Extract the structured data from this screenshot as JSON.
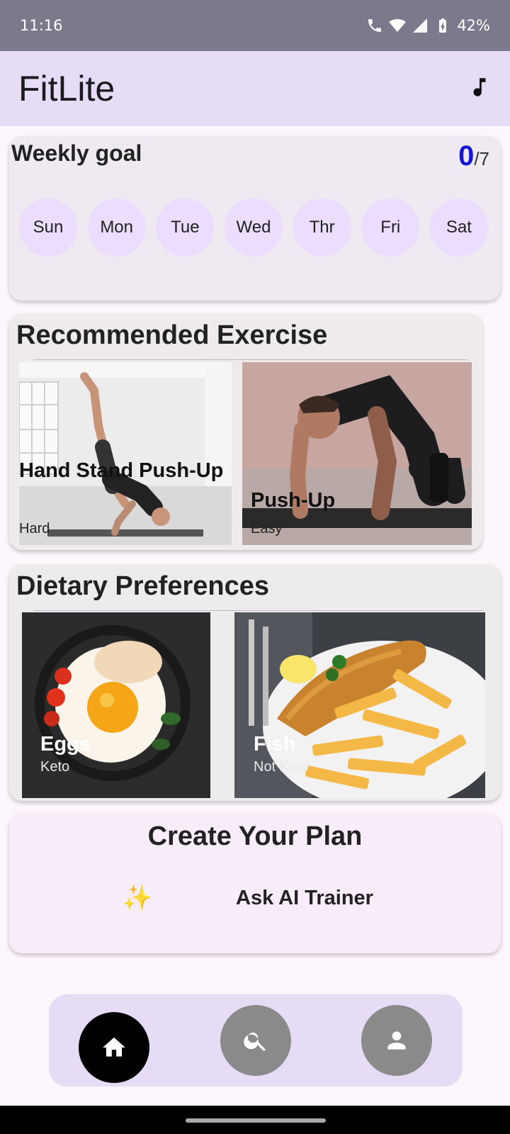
{
  "status_bar": {
    "time": "11:16",
    "battery": "42%"
  },
  "app_bar": {
    "title": "FitLite",
    "action_icon": "music-note-icon"
  },
  "weekly_goal": {
    "title": "Weekly goal",
    "completed": "0",
    "total": "/7",
    "days": [
      "Sun",
      "Mon",
      "Tue",
      "Wed",
      "Thr",
      "Fri",
      "Sat"
    ]
  },
  "recommended_exercise": {
    "title": "Recommended Exercise",
    "items": [
      {
        "name": "Hand Stand Push-Up",
        "difficulty": "Hard"
      },
      {
        "name": "Push-Up",
        "difficulty": "Easy"
      }
    ]
  },
  "dietary_preferences": {
    "title": "Dietary Preferences",
    "items": [
      {
        "name": "Eggs",
        "tag": "Keto"
      },
      {
        "name": "Fish",
        "tag": "Not Keto"
      }
    ]
  },
  "plan": {
    "title": "Create Your Plan",
    "icon": "sparkles-icon",
    "button_label": "Ask AI Trainer",
    "emoji": "✨"
  },
  "bottom_nav": {
    "items": [
      {
        "icon": "home-icon",
        "active": true
      },
      {
        "icon": "search-icon",
        "active": false
      },
      {
        "icon": "person-icon",
        "active": false
      }
    ]
  },
  "colors": {
    "status_bar": "#7b7a8c",
    "app_bar": "#e6dcf5",
    "goal_count": "#1515d6",
    "day_chip": "#ebddfd",
    "nav_active": "#000000",
    "nav_inactive": "#8a8a8a"
  }
}
